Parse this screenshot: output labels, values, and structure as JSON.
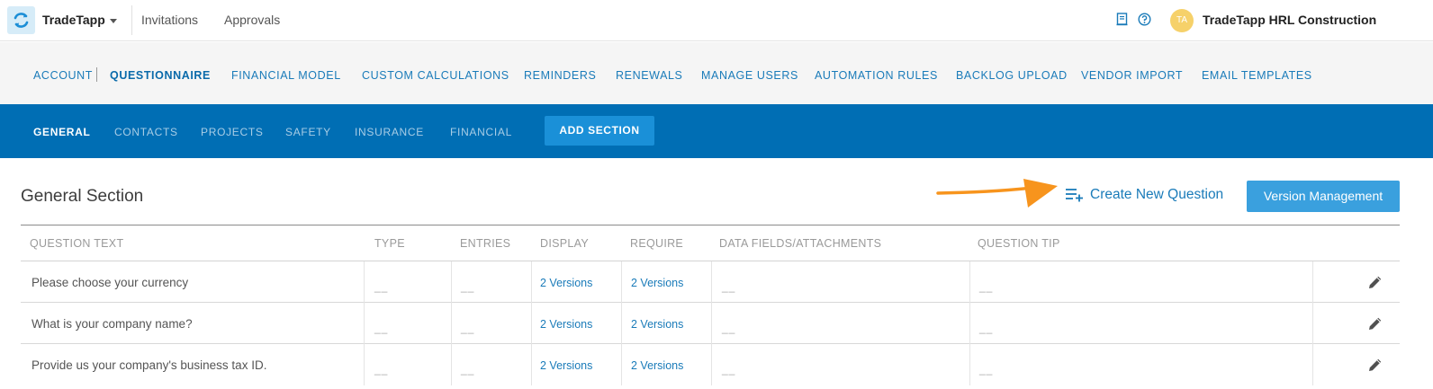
{
  "topbar": {
    "brand": "TradeTapp",
    "links": [
      "Invitations",
      "Approvals"
    ],
    "avatar_initials": "TA",
    "company": "TradeTapp HRL Construction"
  },
  "admin_nav": {
    "items": [
      "ACCOUNT",
      "QUESTIONNAIRE",
      "FINANCIAL MODEL",
      "CUSTOM CALCULATIONS",
      "REMINDERS",
      "RENEWALS",
      "MANAGE USERS",
      "AUTOMATION RULES",
      "BACKLOG UPLOAD",
      "VENDOR IMPORT",
      "EMAIL TEMPLATES"
    ],
    "active": "QUESTIONNAIRE"
  },
  "section_tabs": {
    "items": [
      "GENERAL",
      "CONTACTS",
      "PROJECTS",
      "SAFETY",
      "INSURANCE",
      "FINANCIAL"
    ],
    "active": "GENERAL",
    "add_label": "ADD SECTION"
  },
  "section": {
    "title": "General Section",
    "create_label": "Create New Question",
    "version_button": "Version Management"
  },
  "table": {
    "headers": [
      "QUESTION TEXT",
      "TYPE",
      "ENTRIES",
      "DISPLAY",
      "REQUIRE",
      "DATA FIELDS/ATTACHMENTS",
      "QUESTION TIP"
    ],
    "empty_value": "__",
    "rows": [
      {
        "question": "Please choose your currency",
        "type": "__",
        "entries": "__",
        "display": "2 Versions",
        "require": "2 Versions",
        "data_fields": "__",
        "tip": "__"
      },
      {
        "question": "What is your company name?",
        "type": "__",
        "entries": "__",
        "display": "2 Versions",
        "require": "2 Versions",
        "data_fields": "__",
        "tip": "__"
      },
      {
        "question": "Provide us your company's business tax ID.",
        "type": "__",
        "entries": "__",
        "display": "2 Versions",
        "require": "2 Versions",
        "data_fields": "__",
        "tip": "__"
      }
    ]
  },
  "colors": {
    "primary_blue": "#006eb4",
    "link_blue": "#1a7bb9",
    "button_blue": "#3aa0de",
    "arrow_orange": "#f7941d",
    "avatar_yellow": "#f6d16a"
  }
}
